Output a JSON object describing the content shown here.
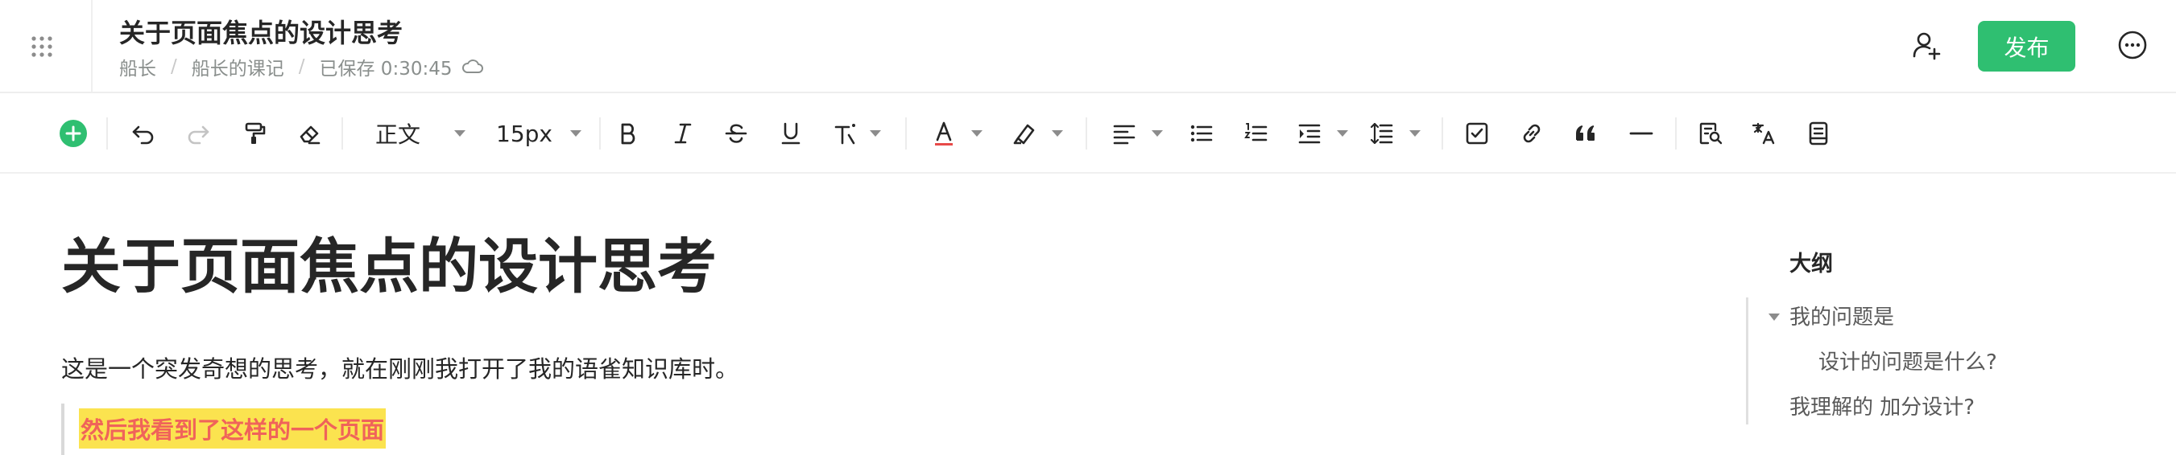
{
  "header": {
    "doc_title": "关于页面焦点的设计思考",
    "breadcrumb": [
      "船长",
      "船长的课记"
    ],
    "separator": "/",
    "save_status": "已保存 0:30:45",
    "publish_label": "发布",
    "accent_color": "#2fbf71"
  },
  "toolbar": {
    "paragraph_style": "正文",
    "font_size": "15px",
    "icons": [
      "add-icon",
      "undo-icon",
      "redo-icon",
      "format-painter-icon",
      "eraser-icon",
      "bold-icon",
      "italic-icon",
      "strikethrough-icon",
      "underline-icon",
      "text-effect-icon",
      "font-color-icon",
      "highlight-icon",
      "align-icon",
      "bullet-list-icon",
      "ordered-list-icon",
      "indent-icon",
      "line-height-icon",
      "task-list-icon",
      "link-icon",
      "quote-icon",
      "divider-icon",
      "find-icon",
      "translate-icon",
      "template-icon"
    ]
  },
  "content": {
    "title": "关于页面焦点的设计思考",
    "paragraph": "这是一个突发奇想的思考，就在刚刚我打开了我的语雀知识库时。",
    "highlight_quote": "然后我看到了这样的一个页面",
    "highlight_bg": "#fbe34f",
    "highlight_text_color": "#f0635a"
  },
  "outline": {
    "title": "大纲",
    "items": [
      {
        "label": "我的问题是"
      },
      {
        "label": "设计的问题是什么?"
      },
      {
        "label": "我理解的 加分设计?"
      }
    ]
  }
}
